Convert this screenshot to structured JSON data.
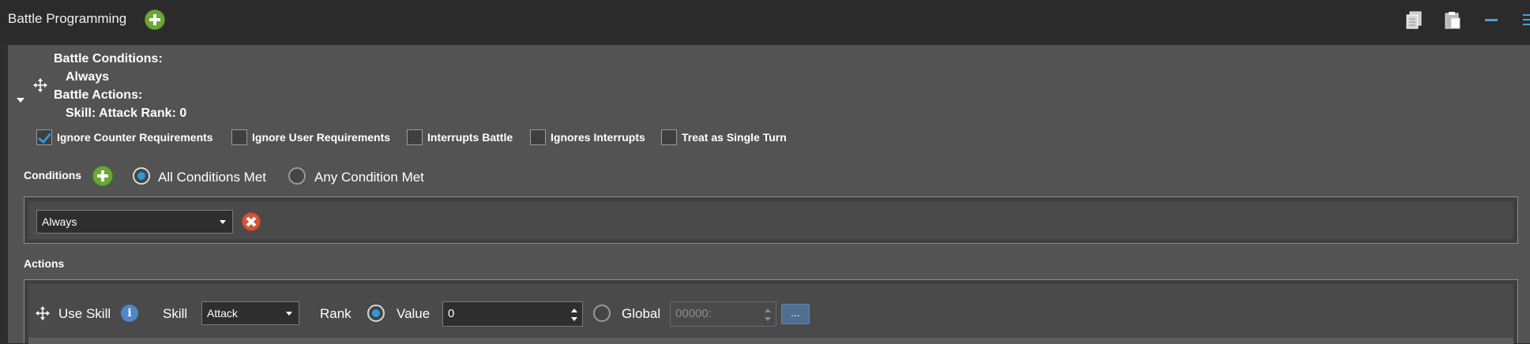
{
  "header": {
    "title": "Battle Programming"
  },
  "summary": {
    "conditions_heading": "Battle Conditions:",
    "conditions_value": "Always",
    "actions_heading": "Battle Actions:",
    "actions_value": "Skill: Attack Rank: 0"
  },
  "flags": [
    {
      "label": "Ignore Counter Requirements",
      "checked": true
    },
    {
      "label": "Ignore User Requirements",
      "checked": false
    },
    {
      "label": "Interrupts Battle",
      "checked": false
    },
    {
      "label": "Ignores Interrupts",
      "checked": false
    },
    {
      "label": "Treat as Single Turn",
      "checked": false
    }
  ],
  "conditions": {
    "label": "Conditions",
    "mode_all": "All Conditions Met",
    "mode_any": "Any Condition Met",
    "selected_mode": "all",
    "rows": [
      {
        "value": "Always"
      }
    ]
  },
  "actions": {
    "label": "Actions",
    "row": {
      "type_label": "Use Skill",
      "skill_label": "Skill",
      "skill_value": "Attack",
      "rank_label": "Rank",
      "value_label": "Value",
      "value": "0",
      "global_label": "Global",
      "global_placeholder": "00000:",
      "browse_label": "...",
      "rank_mode": "value"
    }
  },
  "icons": {
    "add": "plus-circle-icon",
    "remove": "x-circle-icon",
    "move": "move-arrows-icon",
    "info": "info-icon",
    "copy": "copy-icon",
    "paste": "paste-icon",
    "minimize": "minimize-icon",
    "menu": "menu-icon"
  },
  "colors": {
    "accent": "#2d9ad8",
    "add_green": "#69a838",
    "remove_red": "#d4533a",
    "info_blue": "#4e86c8"
  }
}
